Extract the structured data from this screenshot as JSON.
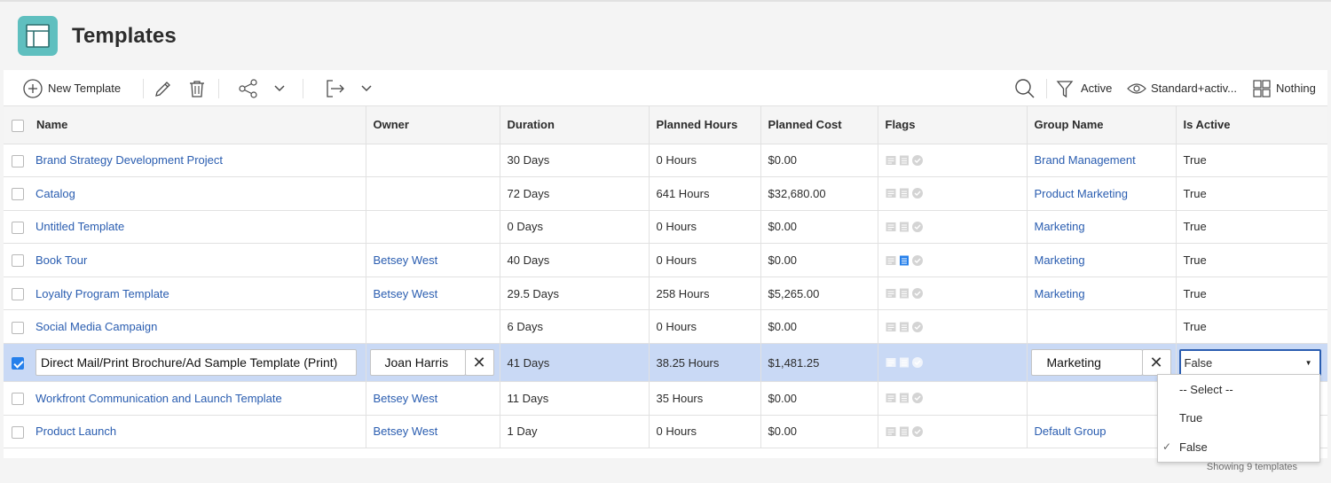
{
  "header": {
    "title": "Templates",
    "app_icon": "layout-icon",
    "accent": "#5fbfbf"
  },
  "toolbar": {
    "new_template": "New Template",
    "filter_label": "Active",
    "view_label": "Standard+activ...",
    "group_label": "Nothing"
  },
  "columns": [
    "Name",
    "Owner",
    "Duration",
    "Planned Hours",
    "Planned Cost",
    "Flags",
    "Group Name",
    "Is Active"
  ],
  "rows": [
    {
      "name": "Brand Strategy Development Project",
      "owner": "",
      "duration": "30 Days",
      "hours": "0 Hours",
      "cost": "$0.00",
      "group": "Brand Management",
      "active": "True"
    },
    {
      "name": "Catalog",
      "owner": "",
      "duration": "72 Days",
      "hours": "641 Hours",
      "cost": "$32,680.00",
      "group": "Product Marketing",
      "active": "True"
    },
    {
      "name": "Untitled Template",
      "owner": "",
      "duration": "0 Days",
      "hours": "0 Hours",
      "cost": "$0.00",
      "group": "Marketing",
      "active": "True"
    },
    {
      "name": "Book Tour",
      "owner": "Betsey West",
      "duration": "40 Days",
      "hours": "0 Hours",
      "cost": "$0.00",
      "group": "Marketing",
      "active": "True"
    },
    {
      "name": "Loyalty Program Template",
      "owner": "Betsey West",
      "duration": "29.5 Days",
      "hours": "258 Hours",
      "cost": "$5,265.00",
      "group": "Marketing",
      "active": "True"
    },
    {
      "name": "Social Media Campaign",
      "owner": "",
      "duration": "6 Days",
      "hours": "0 Hours",
      "cost": "$0.00",
      "group": "",
      "active": "True"
    }
  ],
  "editing_row": {
    "name": "Direct Mail/Print Brochure/Ad Sample Template (Print)",
    "owner": "Joan Harris",
    "duration": "41 Days",
    "hours": "38.25 Hours",
    "cost": "$1,481.25",
    "group": "Marketing",
    "active": "False"
  },
  "rows_after": [
    {
      "name": "Workfront Communication and Launch Template",
      "owner": "Betsey West",
      "duration": "11 Days",
      "hours": "35 Hours",
      "cost": "$0.00",
      "group": "",
      "active": ""
    },
    {
      "name": "Product Launch",
      "owner": "Betsey West",
      "duration": "1 Day",
      "hours": "0 Hours",
      "cost": "$0.00",
      "group": "Default Group",
      "active": ""
    }
  ],
  "dropdown": {
    "options": [
      "-- Select --",
      "True",
      "False"
    ],
    "selected": "False"
  },
  "footer": {
    "status": "Showing 9 templates"
  },
  "colors": {
    "link": "#2a5db0",
    "edit_row": "#c9d9f5",
    "checkbox_checked": "#2680eb"
  }
}
